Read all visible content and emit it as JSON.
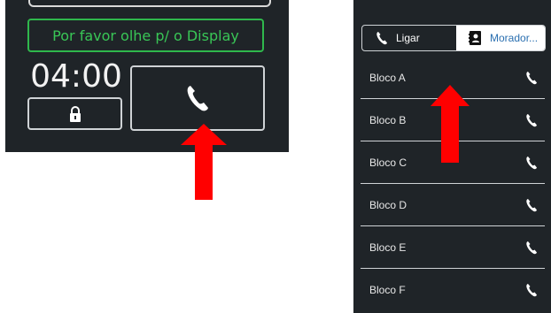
{
  "left_panel": {
    "display_message": "Por favor olhe p/ o Display",
    "timer": "04:00",
    "lock_icon": "lock-icon",
    "call_icon": "phone-icon"
  },
  "right_panel": {
    "tabs": [
      {
        "label": "Ligar",
        "icon": "phone-icon",
        "active": false
      },
      {
        "label": "Morador...",
        "icon": "contacts-icon",
        "active": true
      }
    ],
    "blocks": [
      {
        "label": "Bloco A",
        "icon": "phone-icon"
      },
      {
        "label": "Bloco B",
        "icon": "phone-icon"
      },
      {
        "label": "Bloco C",
        "icon": "phone-icon"
      },
      {
        "label": "Bloco D",
        "icon": "phone-icon"
      },
      {
        "label": "Bloco E",
        "icon": "phone-icon"
      },
      {
        "label": "Bloco F",
        "icon": "phone-icon"
      }
    ]
  },
  "colors": {
    "panel_bg": "#1f2428",
    "display_green": "#39c656",
    "arrow_red": "#ff0000",
    "tab_text_blue": "#2a6fb0"
  }
}
